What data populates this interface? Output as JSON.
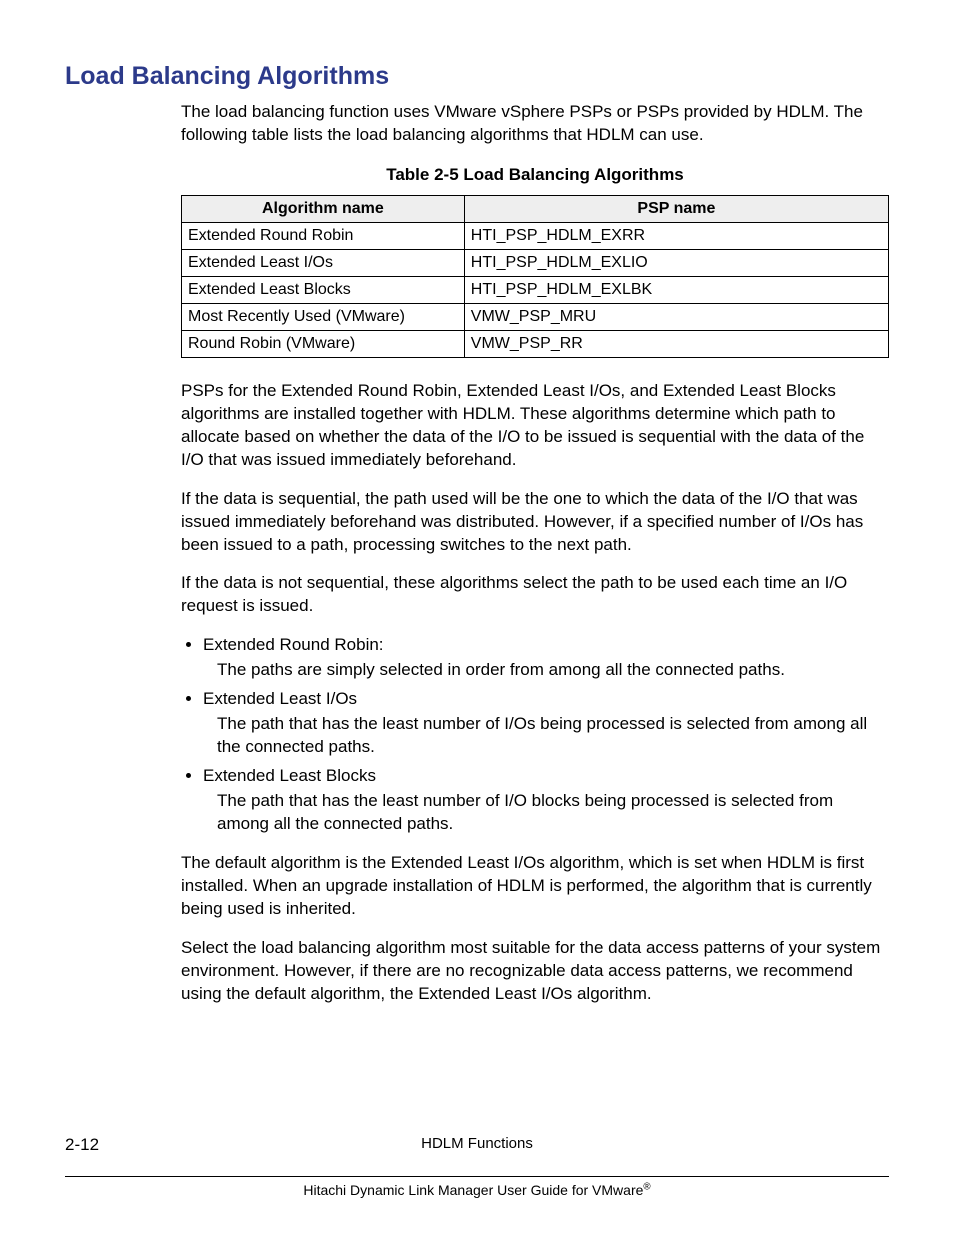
{
  "heading": "Load Balancing Algorithms",
  "intro": "The load balancing function uses VMware vSphere PSPs or PSPs provided by HDLM. The following table lists the load balancing algorithms that HDLM can use.",
  "table": {
    "caption": "Table 2-5 Load Balancing Algorithms",
    "cols": [
      "Algorithm name",
      "PSP name"
    ],
    "rows": [
      [
        "Extended Round Robin",
        "HTI_PSP_HDLM_EXRR"
      ],
      [
        "Extended Least I/Os",
        "HTI_PSP_HDLM_EXLIO"
      ],
      [
        "Extended Least Blocks",
        "HTI_PSP_HDLM_EXLBK"
      ],
      [
        "Most Recently Used (VMware)",
        "VMW_PSP_MRU"
      ],
      [
        "Round Robin (VMware)",
        "VMW_PSP_RR"
      ]
    ]
  },
  "para1": "PSPs for the Extended Round Robin, Extended Least I/Os, and Extended Least Blocks algorithms are installed together with HDLM. These algorithms determine which path to allocate based on whether the data of the I/O to be issued is sequential with the data of the I/O that was issued immediately beforehand.",
  "para2": "If the data is sequential, the path used will be the one to which the data of the I/O that was issued immediately beforehand was distributed. However, if a specified number of I/Os has been issued to a path, processing switches to the next path.",
  "para3": "If the data is not sequential, these algorithms select the path to be used each time an I/O request is issued.",
  "list": [
    {
      "title": "Extended Round Robin:",
      "body": "The paths are simply selected in order from among all the connected paths."
    },
    {
      "title": "Extended Least I/Os",
      "body": "The path that has the least number of I/Os being processed is selected from among all the connected paths."
    },
    {
      "title": "Extended Least Blocks",
      "body": "The path that has the least number of I/O blocks being processed is selected from among all the connected paths."
    }
  ],
  "para4": "The default algorithm is the Extended Least I/Os algorithm, which is set when HDLM is first installed. When an upgrade installation of HDLM is performed, the algorithm that is currently being used is inherited.",
  "para5": "Select the load balancing algorithm most suitable for the data access patterns of your system environment. However, if there are no recognizable data access patterns, we recommend using the default algorithm, the Extended Least I/Os algorithm.",
  "footer": {
    "pagenum": "2-12",
    "chapter": "HDLM Functions",
    "booktitle_prefix": "Hitachi Dynamic Link Manager User Guide for VMware",
    "booktitle_suffix": "®"
  }
}
